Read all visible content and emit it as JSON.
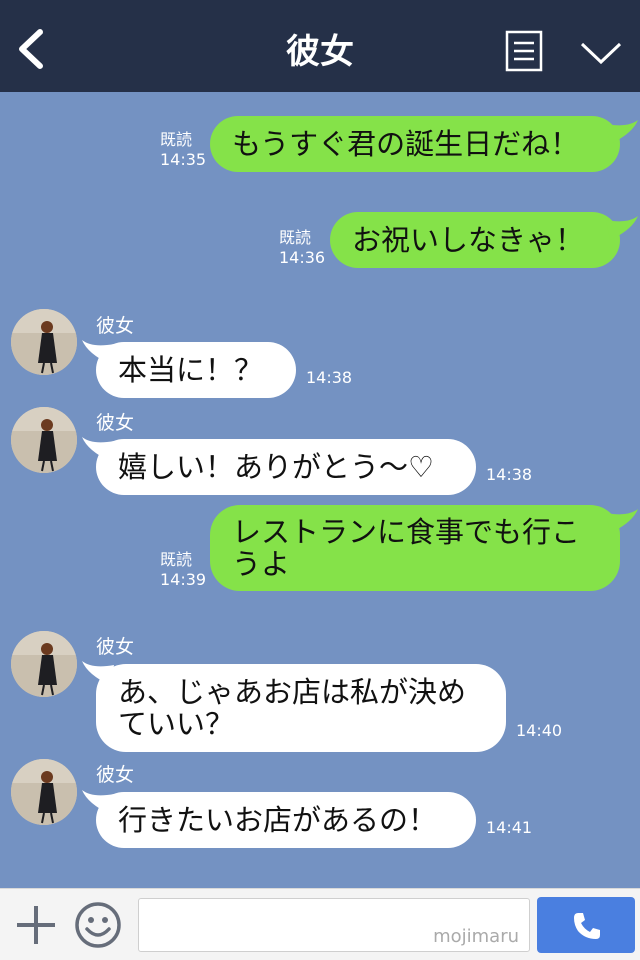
{
  "header": {
    "title": "彼女"
  },
  "messages": [
    {
      "side": "right",
      "text": "もうすぐ君の誕生日だね！",
      "read": "既読",
      "time": "14:35"
    },
    {
      "side": "right",
      "text": "お祝いしなきゃ！",
      "read": "既読",
      "time": "14:36"
    },
    {
      "side": "left",
      "name": "彼女",
      "text": "本当に！？",
      "time": "14:38"
    },
    {
      "side": "left",
      "name": "彼女",
      "text": "嬉しい！ありがとう～♡",
      "time": "14:38"
    },
    {
      "side": "right",
      "text_line1": "レストランに食事でも行こ",
      "text_line2": "うよ",
      "read": "既読",
      "time": "14:39"
    },
    {
      "side": "left",
      "name": "彼女",
      "text_line1": "あ、じゃあお店は私が決め",
      "text_line2": "ていい？",
      "time": "14:40"
    },
    {
      "side": "left",
      "name": "彼女",
      "text": "行きたいお店があるの！",
      "time": "14:41"
    }
  ],
  "input": {
    "watermark": "mojimaru"
  },
  "colors": {
    "header": "#253048",
    "background": "#7492c2",
    "sent_bubble": "#85e249",
    "received_bubble": "#ffffff",
    "call_button": "#4a7fe0"
  }
}
